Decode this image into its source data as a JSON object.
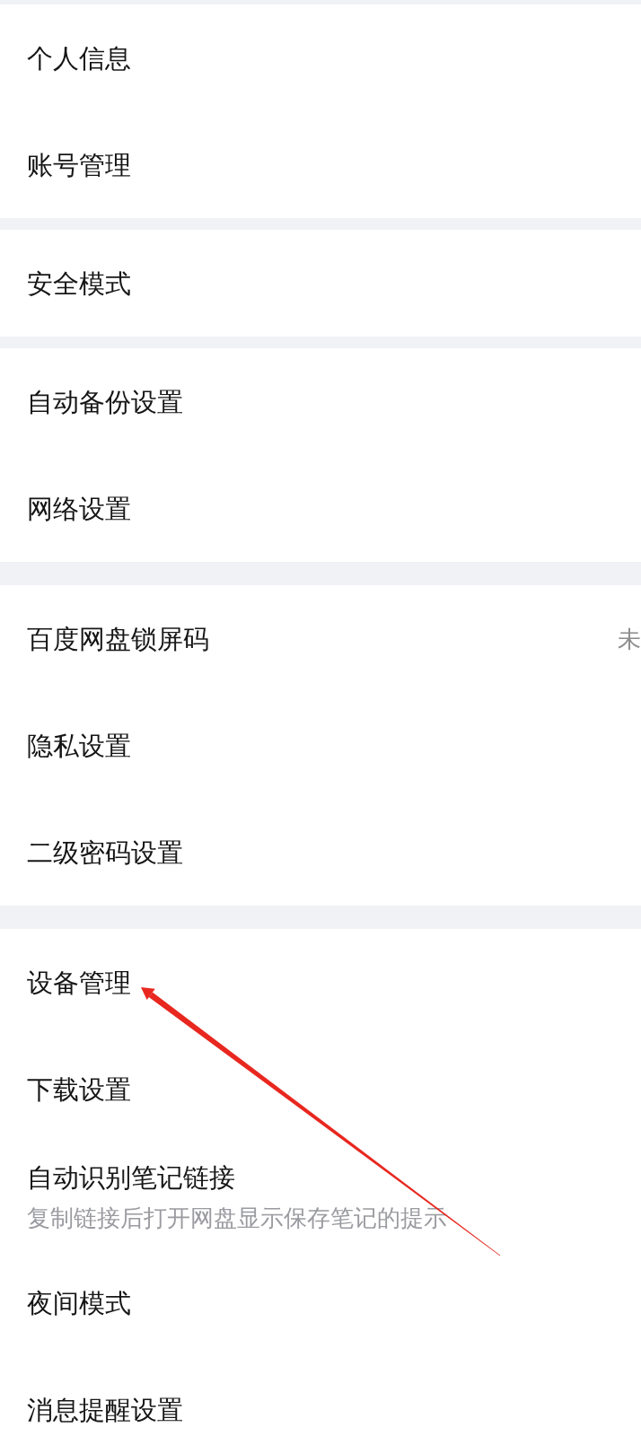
{
  "groups": [
    {
      "items": [
        {
          "title": "个人信息"
        },
        {
          "title": "账号管理"
        }
      ]
    },
    {
      "items": [
        {
          "title": "安全模式"
        }
      ]
    },
    {
      "items": [
        {
          "title": "自动备份设置"
        },
        {
          "title": "网络设置"
        }
      ]
    },
    {
      "items": [
        {
          "title": "百度网盘锁屏码",
          "value": "未"
        },
        {
          "title": "隐私设置"
        },
        {
          "title": "二级密码设置"
        }
      ]
    },
    {
      "items": [
        {
          "title": "设备管理"
        },
        {
          "title": "下载设置"
        },
        {
          "title": "自动识别笔记链接",
          "description": "复制链接后打开网盘显示保存笔记的提示"
        },
        {
          "title": "夜间模式"
        },
        {
          "title": "消息提醒设置"
        }
      ]
    }
  ],
  "annotations": [
    {
      "kind": "arrow"
    }
  ]
}
